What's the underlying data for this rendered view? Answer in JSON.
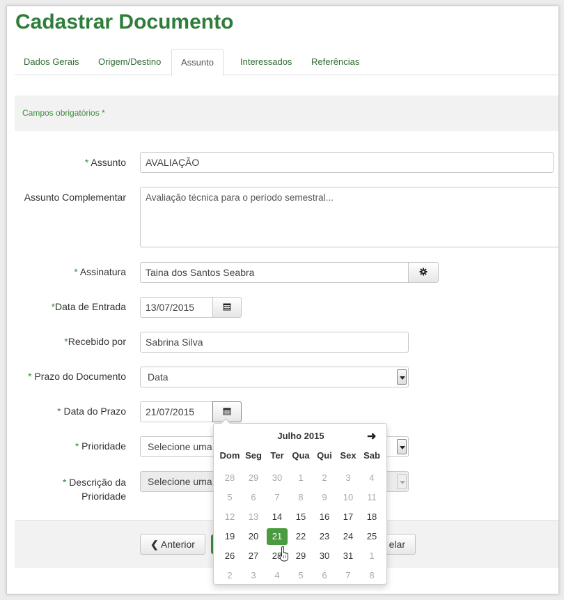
{
  "page_title": "Cadastrar Documento",
  "tabs": [
    {
      "label": "Dados Gerais"
    },
    {
      "label": "Origem/Destino"
    },
    {
      "label": "Assunto"
    },
    {
      "label": "Interessados"
    },
    {
      "label": "Referências"
    }
  ],
  "active_tab": "Assunto",
  "required_note": "Campos obrigatórios *",
  "form": {
    "assunto": {
      "label": "Assunto",
      "value": "AVALIAÇÃO"
    },
    "assunto_complementar": {
      "label": "Assunto Complementar",
      "value": "Avaliação técnica para o período semestral..."
    },
    "assinatura": {
      "label": "Assinatura",
      "value": "Taina dos Santos Seabra",
      "button_icon": "gear-icon"
    },
    "data_entrada": {
      "label": "Data de Entrada",
      "value": "13/07/2015",
      "button_icon": "calendar-icon"
    },
    "recebido_por": {
      "label": "Recebido por",
      "value": "Sabrina Silva"
    },
    "prazo_documento": {
      "label": "Prazo do Documento",
      "value": "Data"
    },
    "data_prazo": {
      "label": "Data do Prazo",
      "value": "21/07/2015",
      "button_icon": "calendar-icon"
    },
    "prioridade": {
      "label": "Prioridade",
      "value": "Selecione uma"
    },
    "descricao_prioridade": {
      "label_line1": "Descrição da",
      "label_line2": "Prioridade",
      "value": "Selecione uma"
    }
  },
  "required_marker": "*",
  "footer": {
    "anterior_label": "Anterior",
    "cancelar_label": "elar"
  },
  "datepicker": {
    "month_label": "Julho 2015",
    "next_icon": "arrow-right-icon",
    "weekdays": [
      "Dom",
      "Seg",
      "Ter",
      "Qua",
      "Qui",
      "Sex",
      "Sab"
    ],
    "weeks": [
      [
        {
          "d": "28",
          "m": true
        },
        {
          "d": "29",
          "m": true
        },
        {
          "d": "30",
          "m": true
        },
        {
          "d": "1",
          "m": true
        },
        {
          "d": "2",
          "m": true
        },
        {
          "d": "3",
          "m": true
        },
        {
          "d": "4",
          "m": true
        }
      ],
      [
        {
          "d": "5",
          "m": true
        },
        {
          "d": "6",
          "m": true
        },
        {
          "d": "7",
          "m": true
        },
        {
          "d": "8",
          "m": true
        },
        {
          "d": "9",
          "m": true
        },
        {
          "d": "10",
          "m": true
        },
        {
          "d": "11",
          "m": true
        }
      ],
      [
        {
          "d": "12",
          "m": true
        },
        {
          "d": "13",
          "m": true
        },
        {
          "d": "14",
          "m": false
        },
        {
          "d": "15",
          "m": false
        },
        {
          "d": "16",
          "m": false
        },
        {
          "d": "17",
          "m": false
        },
        {
          "d": "18",
          "m": false
        }
      ],
      [
        {
          "d": "19",
          "m": false
        },
        {
          "d": "20",
          "m": false
        },
        {
          "d": "21",
          "m": false,
          "sel": true
        },
        {
          "d": "22",
          "m": false
        },
        {
          "d": "23",
          "m": false
        },
        {
          "d": "24",
          "m": false
        },
        {
          "d": "25",
          "m": false
        }
      ],
      [
        {
          "d": "26",
          "m": false
        },
        {
          "d": "27",
          "m": false
        },
        {
          "d": "28",
          "m": false
        },
        {
          "d": "29",
          "m": false
        },
        {
          "d": "30",
          "m": false
        },
        {
          "d": "31",
          "m": false
        },
        {
          "d": "1",
          "m": true
        }
      ],
      [
        {
          "d": "2",
          "m": true
        },
        {
          "d": "3",
          "m": true
        },
        {
          "d": "4",
          "m": true
        },
        {
          "d": "5",
          "m": true
        },
        {
          "d": "6",
          "m": true
        },
        {
          "d": "7",
          "m": true
        },
        {
          "d": "8",
          "m": true
        }
      ]
    ]
  },
  "colors": {
    "brand_green": "#2e7d3a",
    "selected_day": "#4a9a3f"
  }
}
